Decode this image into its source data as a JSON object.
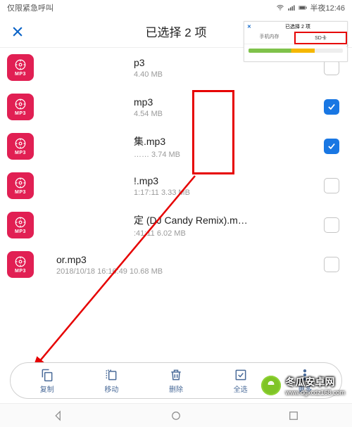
{
  "statusbar": {
    "left": "仅限紧急呼叫",
    "time_label": "半夜12:46"
  },
  "header": {
    "title": "已选择 2 项"
  },
  "mp3_badge_label": "MP3",
  "files": [
    {
      "title": "p3",
      "sub": "4.40 MB",
      "checked": false
    },
    {
      "title": "mp3",
      "sub": "4.54 MB",
      "checked": true
    },
    {
      "title": "集.mp3",
      "sub": "…… 3.74 MB",
      "checked": true
    },
    {
      "title": "!.mp3",
      "sub": "1:17:11 3.33 MB",
      "checked": false
    },
    {
      "title": "定 (DJ Candy Remix).m…",
      "sub": ":41:11 6.02 MB",
      "checked": false
    },
    {
      "title": "or.mp3",
      "sub": "2018/10/18 16:16:49 10.68 MB",
      "checked": false
    }
  ],
  "inset": {
    "title": "已选择 2 项",
    "tab_phone": "手机内存",
    "tab_sd": "SD卡"
  },
  "actions": {
    "copy": "复制",
    "move": "移动",
    "delete": "删除",
    "selall": "全选",
    "more": "更多"
  },
  "watermark": {
    "line1": "冬瓜安卓网",
    "line2": "www.dgxcdz168.com"
  }
}
